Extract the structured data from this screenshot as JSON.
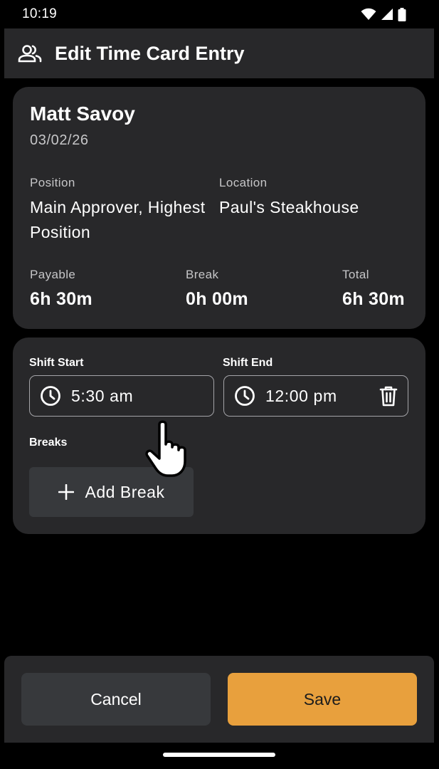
{
  "status_bar": {
    "time": "10:19",
    "icons": [
      "wifi-icon",
      "cellular-signal-icon",
      "battery-icon"
    ]
  },
  "app_bar": {
    "icon": "people-icon",
    "title": "Edit Time Card Entry"
  },
  "employee": {
    "name": "Matt Savoy",
    "date": "03/02/26",
    "position_label": "Position",
    "position_value_line1": "Main Approver, Highest",
    "position_value_line2": "Position",
    "location_label": "Location",
    "location_value": "Paul's Steakhouse"
  },
  "totals": {
    "payable_label": "Payable",
    "payable_value": "6h 30m",
    "break_label": "Break",
    "break_value": "0h 00m",
    "total_label": "Total",
    "total_value": "6h 30m"
  },
  "shift": {
    "start_label": "Shift Start",
    "start_value": "5:30 am",
    "end_label": "Shift End",
    "end_value": "12:00 pm",
    "breaks_label": "Breaks",
    "add_break_label": "Add Break"
  },
  "actions": {
    "cancel_label": "Cancel",
    "save_label": "Save"
  },
  "colors": {
    "background": "#000000",
    "surface": "#28282a",
    "button_secondary": "#37393c",
    "accent": "#e8a03d",
    "muted_text": "#c6c6c8",
    "outline": "#a4a4a8"
  }
}
